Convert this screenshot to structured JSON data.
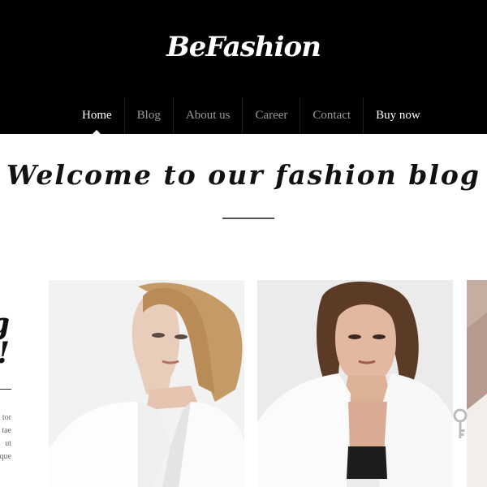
{
  "brand": {
    "name": "BeFashion"
  },
  "nav": {
    "items": [
      {
        "label": "Home",
        "active": true
      },
      {
        "label": "Blog",
        "active": false
      },
      {
        "label": "About us",
        "active": false
      },
      {
        "label": "Career",
        "active": false
      },
      {
        "label": "Contact",
        "active": false
      },
      {
        "label": "Buy now",
        "active": false
      }
    ]
  },
  "hero": {
    "title": "Welcome to our fashion blog"
  },
  "side": {
    "title_line1": "g",
    "title_line2": "!",
    "text_lines": [
      "tor",
      "tae",
      "ut",
      "que"
    ]
  },
  "icons": {
    "key": "key-icon"
  },
  "colors": {
    "header_bg": "#000000",
    "nav_text": "#9a9a9a",
    "nav_active": "#ffffff"
  }
}
